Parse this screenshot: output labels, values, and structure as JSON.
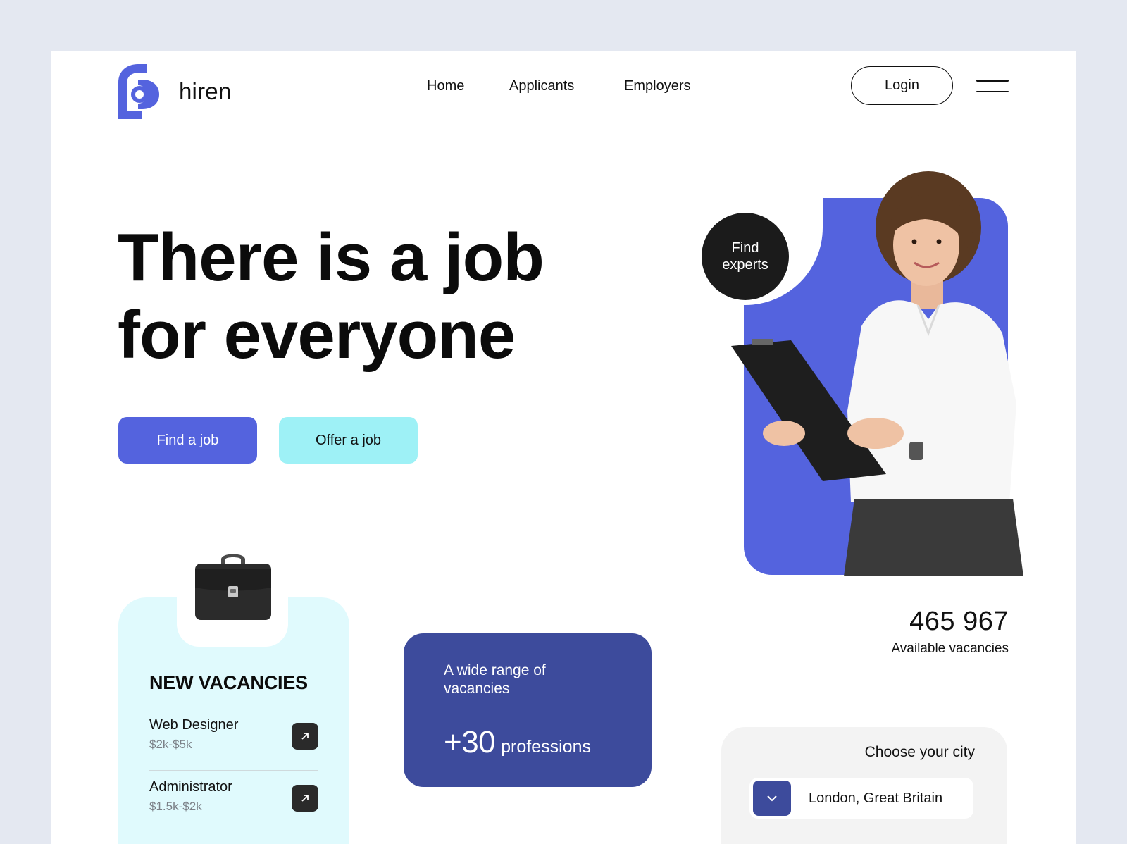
{
  "brand": {
    "name": "hiren",
    "accent_color": "#5463de",
    "dark_accent_color": "#3d4b9c",
    "light_accent_color": "#9ef1f6"
  },
  "nav": {
    "items": [
      "Home",
      "Applicants",
      "Employers"
    ],
    "login_label": "Login",
    "menu_icon": "hamburger-menu-icon"
  },
  "hero": {
    "title_line1": "There is a job",
    "title_line2": "for everyone",
    "find_job_label": "Find a job",
    "offer_job_label": "Offer a job"
  },
  "experts_badge": {
    "label": "Find experts"
  },
  "stats": {
    "count": "465 967",
    "label": "Available vacancies"
  },
  "vacancies": {
    "title": "NEW VACANCIES",
    "items": [
      {
        "role": "Web Designer",
        "salary": "$2k-$5k"
      },
      {
        "role": "Administrator",
        "salary": "$1.5k-$2k"
      }
    ]
  },
  "professions": {
    "subtitle": "A wide range of vacancies",
    "count": "+30",
    "word": "professions"
  },
  "city": {
    "label": "Choose your city",
    "value": "London, Great Britain"
  }
}
